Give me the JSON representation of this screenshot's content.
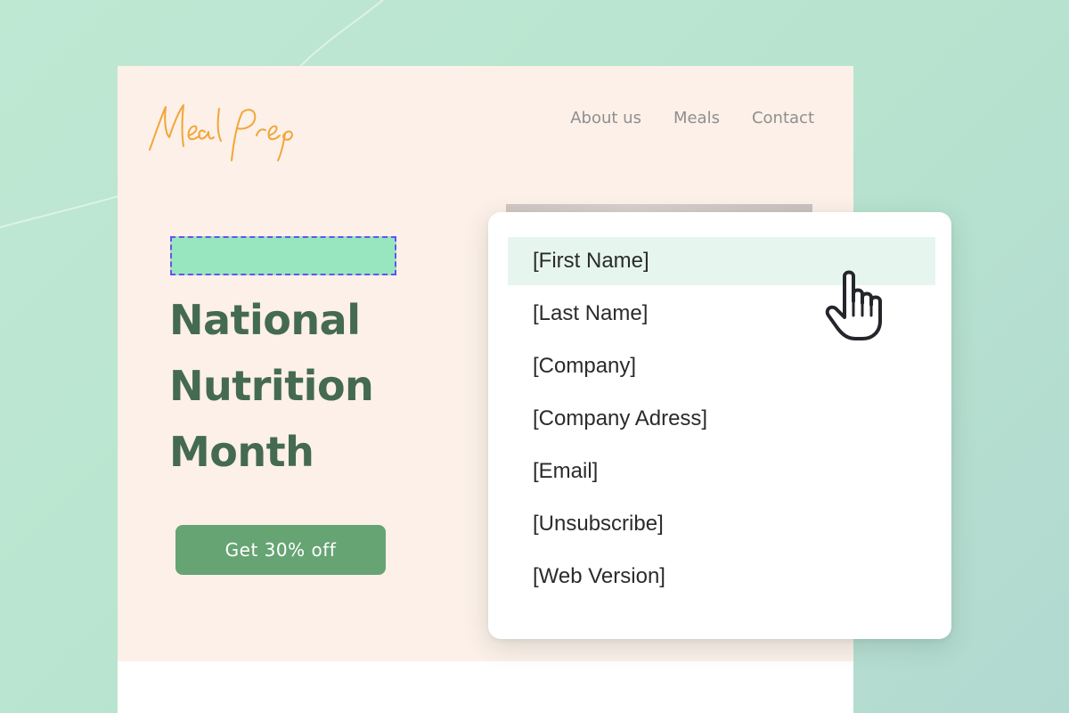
{
  "logo": {
    "text": "MealPrep",
    "color": "#f2a637"
  },
  "nav": {
    "items": [
      "About us",
      "Meals",
      "Contact"
    ]
  },
  "hero": {
    "headline_lines": [
      "National",
      "Nutrition",
      "Month"
    ],
    "cta_label": "Get 30% off"
  },
  "merge_menu": {
    "items": [
      {
        "label": "[First Name]",
        "active": true
      },
      {
        "label": "[Last Name]",
        "active": false
      },
      {
        "label": "[Company]",
        "active": false
      },
      {
        "label": "[Company Adress]",
        "active": false
      },
      {
        "label": "[Email]",
        "active": false
      },
      {
        "label": "[Unsubscribe]",
        "active": false
      },
      {
        "label": "[Web Version]",
        "active": false
      }
    ]
  },
  "colors": {
    "hero_bg": "#fcf0e8",
    "headline": "#456a52",
    "cta": "#66a473",
    "placeholder_fill": "#98e6bf",
    "placeholder_border": "#6a4ff0",
    "menu_highlight": "#e6f6ee"
  },
  "icons": {
    "cursor": "hand-pointer-icon",
    "logo": "mealprep-script-logo"
  }
}
